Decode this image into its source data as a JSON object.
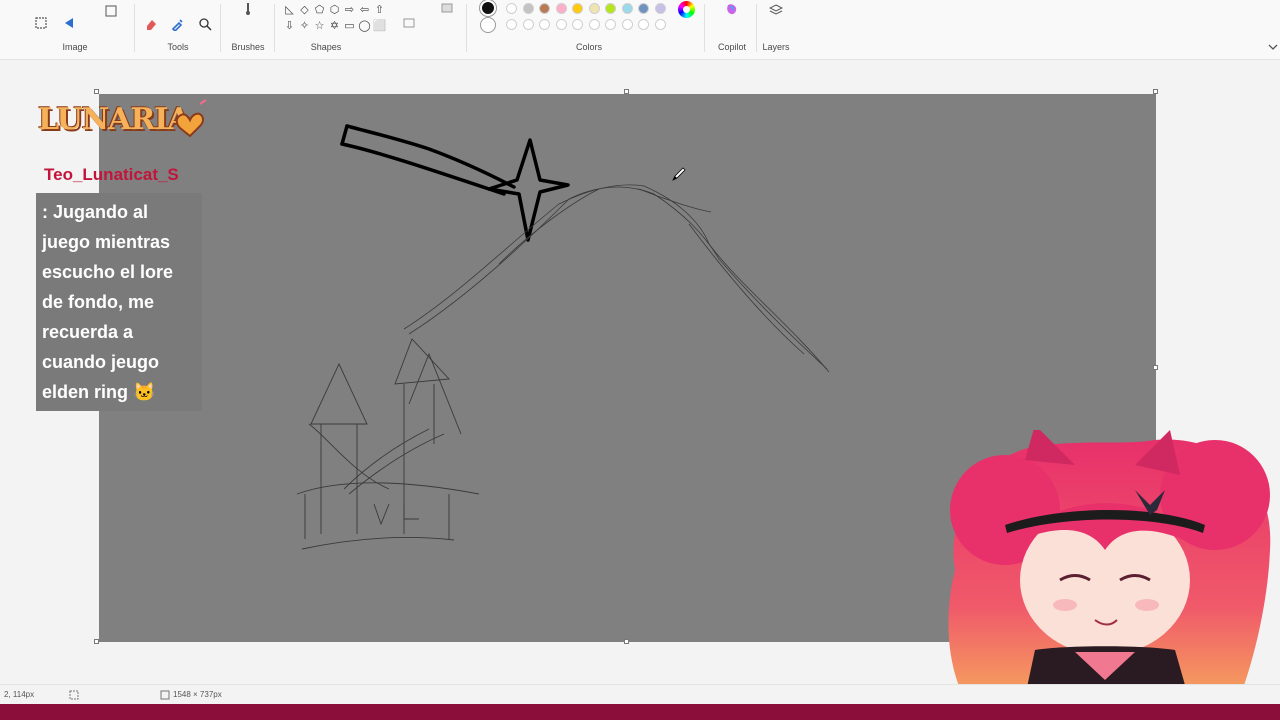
{
  "ribbon": {
    "groups": {
      "image": "Image",
      "tools": "Tools",
      "brushes": "Brushes",
      "shapes": "Shapes",
      "colors": "Colors",
      "copilot": "Copilot",
      "layers": "Layers"
    },
    "shape_glyphs": [
      "◺",
      "◇",
      "⬠",
      "⬡",
      "⇨",
      "⇦",
      "⇧",
      "⇩",
      "✧",
      "☆",
      "✡",
      "▭",
      "◯",
      "⬜"
    ],
    "palette_row1": [
      "#ffffff",
      "#c3c3c3",
      "#b97a56",
      "#ffaec9",
      "#ffc90e",
      "#efe4b0",
      "#b5e61d",
      "#99d9ea",
      "#7092be",
      "#c8bfe7"
    ],
    "palette_row2": [
      "#ffffff",
      "#ffffff",
      "#ffffff",
      "#ffffff",
      "#ffffff",
      "#ffffff",
      "#ffffff",
      "#ffffff",
      "#ffffff",
      "#ffffff"
    ],
    "primary_color": "#000000"
  },
  "chat": {
    "logo": "LUNARIA",
    "username": "Teo_Lunaticat_S",
    "message": ": Jugando al juego mientras escucho el lore de fondo, me recuerda a cuando jeugo elden ring 🐱"
  },
  "status": {
    "cursor_position": "2, 114px",
    "canvas_size": "1548 × 737px"
  },
  "colors": {
    "canvas": "#808080",
    "accent": "#8b0e3a",
    "username": "#c2153b"
  }
}
